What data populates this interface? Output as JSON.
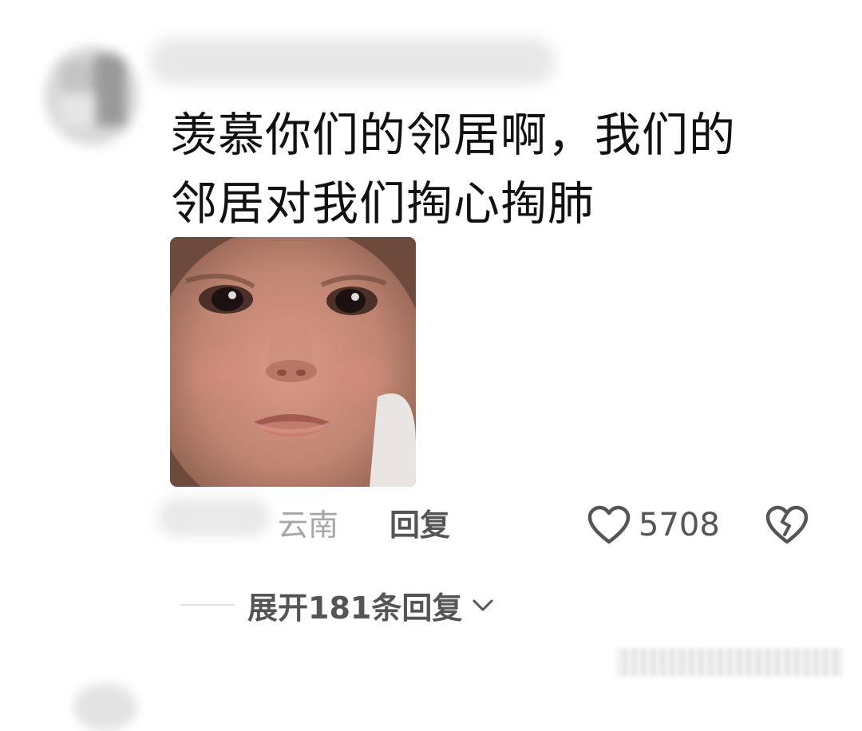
{
  "comment": {
    "text_line1": "羡慕你们的邻居啊，我们的",
    "text_line2": "邻居对我们掏心掏肺",
    "location": "云南",
    "reply_label": "回复",
    "like_count": "5708",
    "expand_label": "展开181条回复"
  },
  "icons": {
    "like": "heart-icon",
    "dislike": "broken-heart-icon",
    "expand": "chevron-down-icon"
  },
  "colors": {
    "text_primary": "#111111",
    "text_secondary": "#555555",
    "text_muted": "#a6a6a6"
  }
}
